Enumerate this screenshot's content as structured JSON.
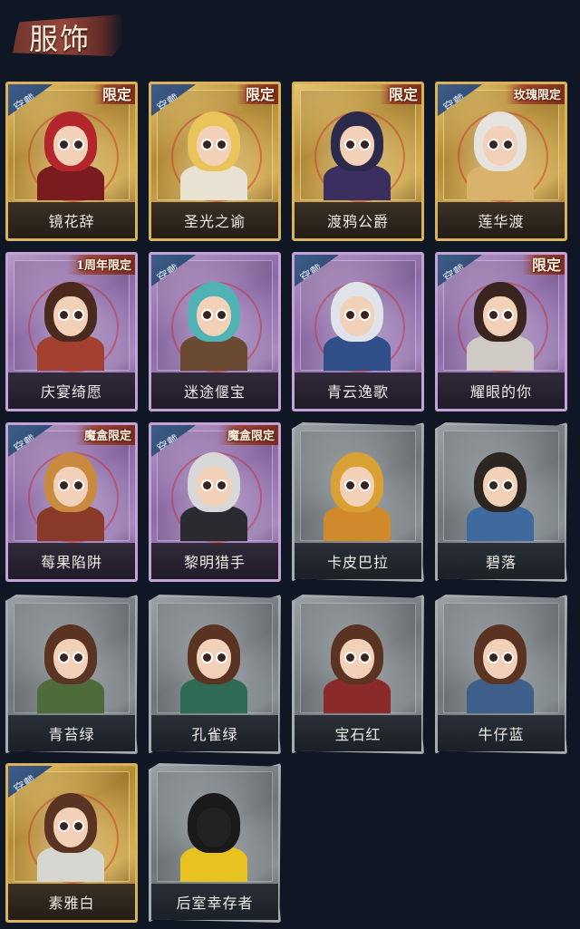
{
  "header": {
    "title": "服饰"
  },
  "wear_label": "穿戴",
  "cards": [
    {
      "name": "镜花辞",
      "frame": "gold",
      "worn": true,
      "badge": "限定",
      "hair": "#b3262b",
      "outfit": "#7a1b1f"
    },
    {
      "name": "圣光之谕",
      "frame": "gold",
      "worn": true,
      "badge": "限定",
      "hair": "#e8c45a",
      "outfit": "#e9e2d2"
    },
    {
      "name": "渡鸦公爵",
      "frame": "gold",
      "worn": false,
      "badge": "限定",
      "hair": "#2b2a4a",
      "outfit": "#3a2f5e"
    },
    {
      "name": "莲华渡",
      "frame": "gold",
      "worn": true,
      "badge": "玫瑰限定",
      "hair": "#e6e2dd",
      "outfit": "#d9b26b"
    },
    {
      "name": "庆宴绮愿",
      "frame": "purple",
      "worn": false,
      "badge": "1周年限定",
      "hair": "#4a2a1d",
      "outfit": "#a3402f"
    },
    {
      "name": "迷途偃宝",
      "frame": "purple",
      "worn": true,
      "badge": "",
      "hair": "#4fb3b6",
      "outfit": "#6b4a33"
    },
    {
      "name": "青云逸歌",
      "frame": "purple",
      "worn": true,
      "badge": "",
      "hair": "#dfe3ea",
      "outfit": "#2f4f8a"
    },
    {
      "name": "耀眼的你",
      "frame": "purple",
      "worn": true,
      "badge": "限定",
      "hair": "#3a2420",
      "outfit": "#cfcac4"
    },
    {
      "name": "莓果陷阱",
      "frame": "purple",
      "worn": true,
      "badge": "魔盒限定",
      "hair": "#c98a3f",
      "outfit": "#8a3a28"
    },
    {
      "name": "黎明猎手",
      "frame": "purple",
      "worn": true,
      "badge": "魔盒限定",
      "hair": "#d8d8d8",
      "outfit": "#2a2a30"
    },
    {
      "name": "卡皮巴拉",
      "frame": "grey",
      "worn": false,
      "badge": "",
      "hair": "#d9a033",
      "outfit": "#d08a2c"
    },
    {
      "name": "碧落",
      "frame": "grey",
      "worn": false,
      "badge": "",
      "hair": "#2d2520",
      "outfit": "#3e6aa0"
    },
    {
      "name": "青苔绿",
      "frame": "grey",
      "worn": false,
      "badge": "",
      "hair": "#5a3322",
      "outfit": "#4e6b3a"
    },
    {
      "name": "孔雀绿",
      "frame": "grey",
      "worn": false,
      "badge": "",
      "hair": "#5a3322",
      "outfit": "#2f6a55"
    },
    {
      "name": "宝石红",
      "frame": "grey",
      "worn": false,
      "badge": "",
      "hair": "#5a3322",
      "outfit": "#8a2a2a"
    },
    {
      "name": "牛仔蓝",
      "frame": "grey",
      "worn": false,
      "badge": "",
      "hair": "#5a3322",
      "outfit": "#3e5f8a"
    },
    {
      "name": "素雅白",
      "frame": "gold",
      "worn": true,
      "badge": "",
      "hair": "#5a3322",
      "outfit": "#d7d7d2"
    },
    {
      "name": "后室幸存者",
      "frame": "grey",
      "worn": false,
      "badge": "",
      "hair": "#1a1a1a",
      "outfit": "#e8c21e"
    }
  ]
}
